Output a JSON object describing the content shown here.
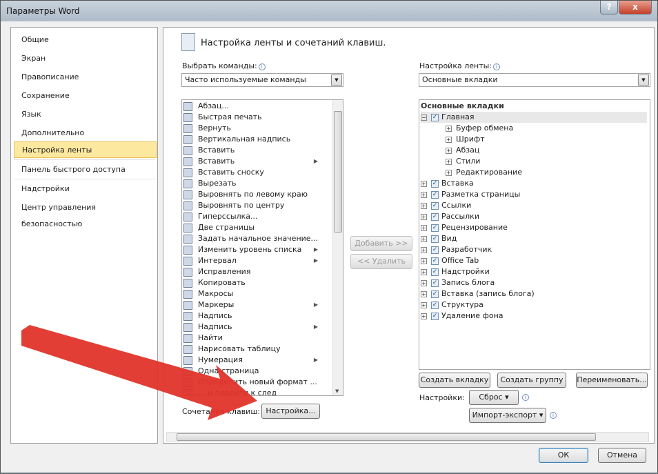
{
  "window": {
    "title": "Параметры Word",
    "help": "?",
    "close": "x"
  },
  "nav": {
    "items": [
      "Общие",
      "Экран",
      "Правописание",
      "Сохранение",
      "Язык",
      "Дополнительно",
      "Настройка ленты",
      "Панель быстрого доступа",
      "Надстройки",
      "Центр управления безопасностью"
    ],
    "selected": "Настройка ленты"
  },
  "header": {
    "title": "Настройка ленты и сочетаний клавиш."
  },
  "left": {
    "label": "Выбрать команды:",
    "combo_value": "Часто используемые команды",
    "commands": [
      {
        "label": "Абзац...",
        "icon": "paragraph-icon"
      },
      {
        "label": "Быстрая печать",
        "icon": "quick-print-icon"
      },
      {
        "label": "Вернуть",
        "icon": "redo-icon"
      },
      {
        "label": "Вертикальная надпись",
        "icon": "vertical-textbox-icon"
      },
      {
        "label": "Вставить",
        "icon": "paste-icon"
      },
      {
        "label": "Вставить",
        "icon": "paste-icon",
        "submenu": true
      },
      {
        "label": "Вставить сноску",
        "icon": "footnote-icon"
      },
      {
        "label": "Вырезать",
        "icon": "cut-icon"
      },
      {
        "label": "Выровнять по левому краю",
        "icon": "align-left-icon"
      },
      {
        "label": "Выровнять по центру",
        "icon": "align-center-icon"
      },
      {
        "label": "Гиперссылка...",
        "icon": "hyperlink-icon"
      },
      {
        "label": "Две страницы",
        "icon": "two-pages-icon"
      },
      {
        "label": "Задать начальное значение...",
        "icon": "set-numbering-icon"
      },
      {
        "label": "Изменить уровень списка",
        "icon": "list-level-icon",
        "submenu": true
      },
      {
        "label": "Интервал",
        "icon": "spacing-icon",
        "submenu": true
      },
      {
        "label": "Исправления",
        "icon": "track-changes-icon"
      },
      {
        "label": "Копировать",
        "icon": "copy-icon"
      },
      {
        "label": "Макросы",
        "icon": "macros-icon"
      },
      {
        "label": "Маркеры",
        "icon": "bullets-icon",
        "submenu": true
      },
      {
        "label": "Надпись",
        "icon": "textbox-icon"
      },
      {
        "label": "Надпись",
        "icon": "textbox-icon",
        "submenu": true
      },
      {
        "label": "Найти",
        "icon": "find-icon"
      },
      {
        "label": "Нарисовать таблицу",
        "icon": "draw-table-icon"
      },
      {
        "label": "Нумерация",
        "icon": "numbering-icon",
        "submenu": true
      },
      {
        "label": "Одна страница",
        "icon": "one-page-icon"
      },
      {
        "label": "Определить новый формат ...",
        "icon": "new-format-icon"
      },
      {
        "label": "... и перейти к след",
        "icon": "next-icon"
      }
    ],
    "shortcuts_label": "Сочетания клавиш:",
    "shortcuts_button": "Настройка..."
  },
  "middle": {
    "add": "Добавить >>",
    "remove": "<< Удалить"
  },
  "right": {
    "label": "Настройка ленты:",
    "combo_value": "Основные вкладки",
    "tree_header": "Основные вкладки",
    "tabs": [
      {
        "label": "Главная",
        "checked": true,
        "expanded": true,
        "groups": [
          "Буфер обмена",
          "Шрифт",
          "Абзац",
          "Стили",
          "Редактирование"
        ]
      },
      {
        "label": "Вставка",
        "checked": true
      },
      {
        "label": "Разметка страницы",
        "checked": true
      },
      {
        "label": "Ссылки",
        "checked": true
      },
      {
        "label": "Рассылки",
        "checked": true
      },
      {
        "label": "Рецензирование",
        "checked": true
      },
      {
        "label": "Вид",
        "checked": true
      },
      {
        "label": "Разработчик",
        "checked": true
      },
      {
        "label": "Office Tab",
        "checked": true
      },
      {
        "label": "Надстройки",
        "checked": true
      },
      {
        "label": "Запись блога",
        "checked": true
      },
      {
        "label": "Вставка (запись блога)",
        "checked": true
      },
      {
        "label": "Структура",
        "checked": true
      },
      {
        "label": "Удаление фона",
        "checked": true
      }
    ],
    "new_tab": "Создать вкладку",
    "new_group": "Создать группу",
    "rename": "Переименовать...",
    "settings_label": "Настройки:",
    "reset": "Сброс ▾",
    "import_export": "Импорт-экспорт ▾"
  },
  "footer": {
    "ok": "ОК",
    "cancel": "Отмена"
  },
  "colors": {
    "selection": "#fde8a0",
    "arrow": "#e0342a"
  }
}
